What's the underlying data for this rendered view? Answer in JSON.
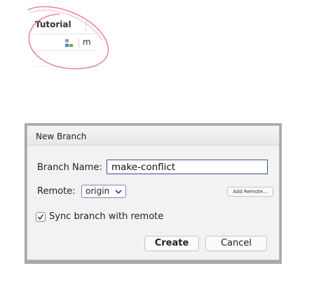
{
  "background_tab": {
    "label": "Tutorial",
    "toolbar_label": "m"
  },
  "dialog": {
    "title": "New Branch",
    "branch_name_label": "Branch Name:",
    "branch_name_value": "make-conflict",
    "remote_label": "Remote:",
    "remote_selected": "origin",
    "add_remote_label": "Add Remote...",
    "sync_label": "Sync branch with remote",
    "sync_checked": true,
    "create_label": "Create",
    "cancel_label": "Cancel"
  },
  "colors": {
    "annotation": "#e5737e",
    "input_border": "#3c4a8c",
    "dialog_bg": "#f2f2f2"
  },
  "icons": {
    "branch": "branch-icon",
    "dropdown": "chevron-down-icon",
    "check": "checkmark-icon"
  }
}
